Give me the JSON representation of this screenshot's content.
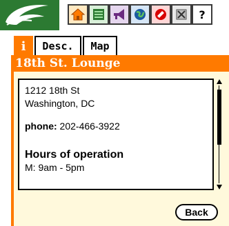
{
  "toolbar": {
    "items": [
      {
        "icon": "home-icon",
        "color": "#ff7a00"
      },
      {
        "icon": "list-icon",
        "color": "#2c7a32"
      },
      {
        "icon": "megaphone-icon",
        "color": "#6b2a80"
      },
      {
        "icon": "globe-icon",
        "color": "#1a5aa0"
      },
      {
        "icon": "no-entry-icon",
        "color": "#d80000"
      },
      {
        "icon": "tools-icon",
        "color": "#7a7a7a"
      }
    ],
    "help_label": "?"
  },
  "tabs": {
    "info_label": "i",
    "items": [
      {
        "label": "Desc."
      },
      {
        "label": "Map"
      }
    ]
  },
  "title": "18th St. Lounge",
  "details": {
    "address_line1": "1212 18th St",
    "address_line2": "Washington, DC",
    "phone_label": "phone:",
    "phone_value": "202-466-3922",
    "hours_heading": "Hours of operation",
    "hours_line1": "M:  9am - 5pm"
  },
  "back_label": "Back",
  "colors": {
    "accent": "#ff7a00",
    "logo_bg": "#2c7a32",
    "content_bg": "#fff9dc"
  }
}
